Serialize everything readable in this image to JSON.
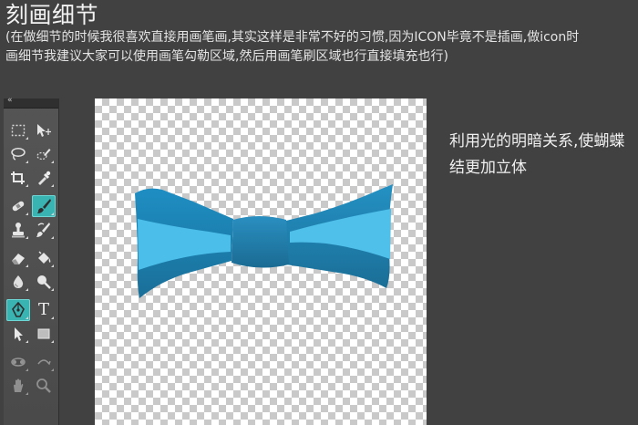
{
  "header": {
    "title": "刻画细节",
    "description_lines": [
      "(在做细节的时候我很喜欢直接用画笔画,其实这样是非常不好的习惯,因为ICON毕竟不是插画,做icon时",
      "画细节我建议大家可以使用画笔勾勒区域,然后用画笔刷区域也行直接填充也行)"
    ]
  },
  "side_note": {
    "lines": [
      "利用光的明暗关系,使蝴蝶",
      "结更加立体"
    ]
  },
  "toolbox": {
    "collapse_glyph": "«",
    "highlighted_tools": [
      "brush-tool",
      "pen-tool"
    ],
    "text_tool_glyph": "T"
  },
  "colors": {
    "background": "#414141",
    "highlight": "#3ab3b3",
    "bow_dark": "#1a6e96",
    "bow_mid": "#1f86b5",
    "bow_light": "#45b9e6"
  }
}
